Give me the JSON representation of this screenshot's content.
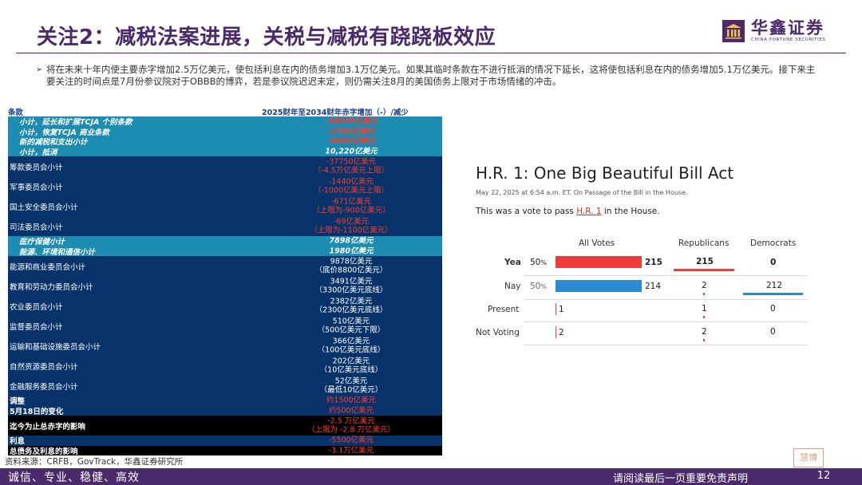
{
  "header": {
    "title": "关注2：减税法案进展，关税与减税有跷跷板效应",
    "logo_cn": "华鑫证券",
    "logo_en": "CHINA FORTUNE SECURITIES",
    "logo_icon": "building-logo-icon"
  },
  "bullet": {
    "text": "将在未来十年内使主要赤字增加2.5万亿美元，使包括利息在内的债务增加3.1万亿美元。如果其临时条款在不进行抵消的情况下延长，这将使包括利息在内的债务增加5.1万亿美元。接下来主要关注的时间点是7月份参议院对于OBBB的博弈，若是参议院迟迟未定，则仍需关注8月的美国债务上限对于市场情绪的冲击。"
  },
  "table": {
    "header_col1": "条款",
    "header_col2": "2025财年至2034财年赤字增加（-）/减少",
    "rows": [
      {
        "label": "小计，延长和扩展TCJA 个别条款",
        "value": "-38550亿美元"
      },
      {
        "label": "小计，恢复TCJA 商业条款",
        "value": "-2780亿美元"
      },
      {
        "label": "新的减税和支出小计",
        "value": "-6640亿美元"
      },
      {
        "label": "小计，抵消",
        "value": "10,220亿美元"
      },
      {
        "label": "筹款委员会小计",
        "value": "-37750亿美元",
        "value2": "（-4.5万亿美元上限）"
      },
      {
        "label": "军事委员会小计",
        "value": "-1440亿美元",
        "value2": "（-1000亿美元上限）"
      },
      {
        "label": "国土安全委员会小计",
        "value": "-671亿美元",
        "value2": "（上限为-900亿美元）"
      },
      {
        "label": "司法委员会小计",
        "value": "-69亿美元",
        "value2": "（上限为-1100亿美元）"
      },
      {
        "label": "医疗保健小计",
        "value": "7898亿美元"
      },
      {
        "label": "能源、环境和通信小计",
        "value": "1980亿美元"
      },
      {
        "label": "能源和商业委员会小计",
        "value": "9878亿美元",
        "value2": "（底价8800亿美元）"
      },
      {
        "label": "教育和劳动力委员会小计",
        "value": "3491亿美元",
        "value2": "（3300亿美元底线）"
      },
      {
        "label": "农业委员会小计",
        "value": "2382亿美元",
        "value2": "（2300亿美元底线）"
      },
      {
        "label": "监督委员会小计",
        "value": "510亿美元",
        "value2": "（500亿美元下限）"
      },
      {
        "label": "运输和基础设施委员会小计",
        "value": "366亿美元",
        "value2": "（100亿美元底线）"
      },
      {
        "label": "自然资源委员会小计",
        "value": "202亿美元",
        "value2": "（10亿美元底线）"
      },
      {
        "label": "金融服务委员会小计",
        "value": "52亿美元",
        "value2": "（最低10亿美元）"
      },
      {
        "label": "调整",
        "value": "约1500亿美元"
      },
      {
        "label": "5月18日的变化",
        "value": "约500亿美元"
      },
      {
        "label": "迄今为止总赤字的影响",
        "value": "-2.5 万亿美元",
        "value2": "（上限为 -2.8 万亿美元）"
      },
      {
        "label": "利息",
        "value": "-5500亿美元"
      },
      {
        "label": "总债务及利息的影响",
        "value": "-3.1万亿美元"
      }
    ]
  },
  "source": "资料来源：CRFB，GovTrack，华鑫证券研究所",
  "vote": {
    "title": "H.R. 1: One Big Beautiful Bill Act",
    "date": "May 22, 2025 at 6:54 a.m. ET. On Passage of the Bill in the House.",
    "desc_prefix": "This was a vote to pass ",
    "desc_link": "H.R. 1",
    "desc_suffix": " in the House.",
    "columns": [
      "All Votes",
      "Republicans",
      "Democrats"
    ],
    "rows": [
      {
        "label": "Yea",
        "pct": "50",
        "pct_unit": "%",
        "all": "215",
        "rep": "215",
        "dem": "0",
        "share": 0.5,
        "color": "#ee3b3b"
      },
      {
        "label": "Nay",
        "pct": "50",
        "pct_unit": "%",
        "all": "214",
        "rep": "2",
        "dem": "212",
        "share": 0.5,
        "color": "#2a8bd0"
      },
      {
        "label": "Present",
        "all": "1",
        "rep": "1",
        "dem": "0"
      },
      {
        "label": "Not Voting",
        "all": "2",
        "rep": "2",
        "dem": "0"
      }
    ]
  },
  "footer": {
    "slogan": "诚信、专业、稳健、高效",
    "disclaimer": "请阅读最后一页重要免责声明",
    "page": "12"
  }
}
